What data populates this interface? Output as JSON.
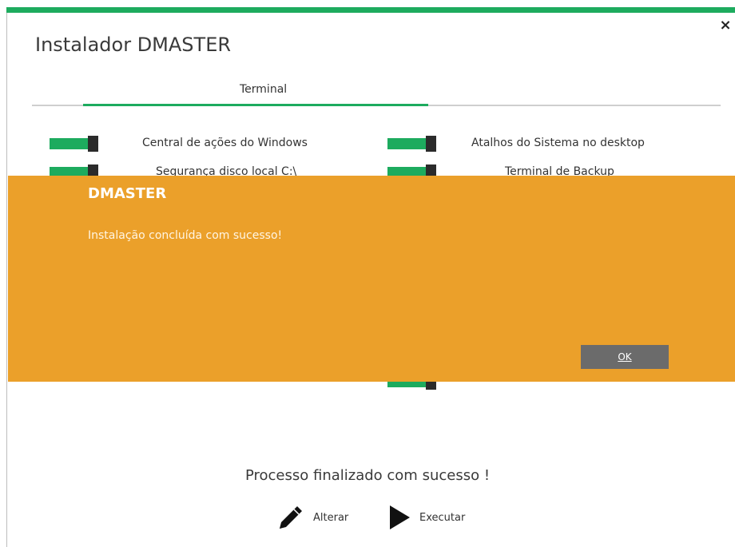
{
  "window": {
    "title": "Instalador DMASTER",
    "close_symbol": "×",
    "accent_color": "#1dab5e"
  },
  "tabs": [
    {
      "label": "Terminal",
      "active": true
    }
  ],
  "toggles": [
    {
      "label": "Central de ações do Windows",
      "on": true
    },
    {
      "label": "Atalhos do Sistema no desktop",
      "on": true
    },
    {
      "label": "Segurança disco local C:\\",
      "on": true
    },
    {
      "label": "Terminal de Backup",
      "on": true
    }
  ],
  "dialog": {
    "title": "DMASTER",
    "message": "Instalação concluída com sucesso!",
    "ok_label": "OK",
    "background": "#eba02a"
  },
  "footer": {
    "status": "Processo finalizado com sucesso !",
    "alterar_label": "Alterar",
    "executar_label": "Executar",
    "alterar_icon": "pencil-icon",
    "executar_icon": "play-icon"
  }
}
